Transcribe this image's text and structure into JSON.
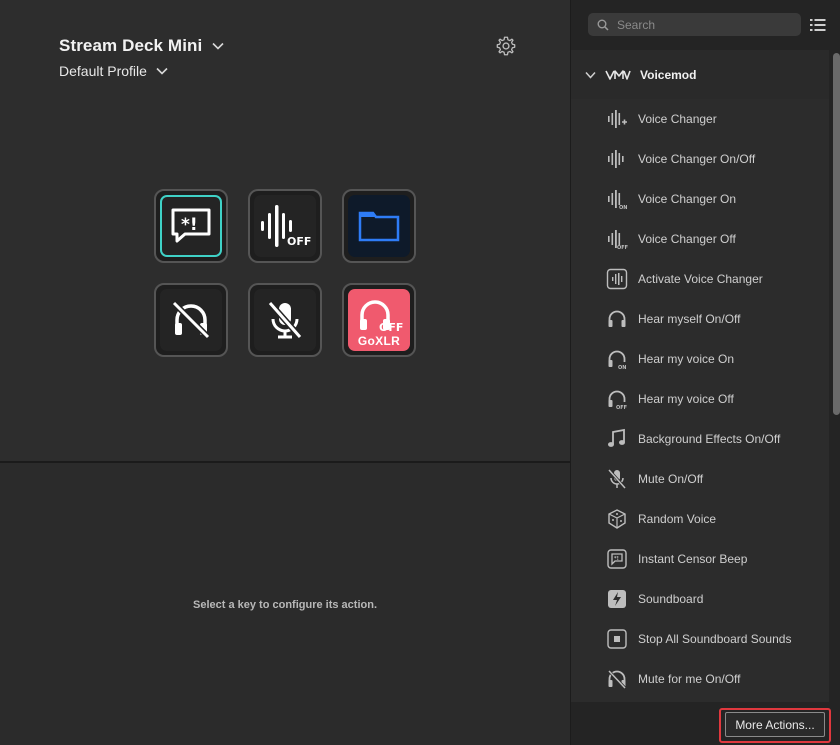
{
  "header": {
    "device_name": "Stream Deck Mini",
    "profile_name": "Default Profile"
  },
  "keys": [
    {
      "icon": "censor-chat-icon",
      "accent": "#3fd2c7"
    },
    {
      "icon": "voice-changer-off-icon",
      "badge": "OFF"
    },
    {
      "icon": "folder-icon",
      "accent": "#2e7cf6"
    },
    {
      "icon": "hear-myself-off-icon"
    },
    {
      "icon": "mic-muted-icon"
    },
    {
      "icon": "goxlr-headphones-off-icon",
      "badge": "OFF",
      "label": "GoXLR",
      "accent": "#f05a6e"
    }
  ],
  "inspector": {
    "hint": "Select a key to configure its action."
  },
  "actions_panel": {
    "search_placeholder": "Search",
    "category": "Voicemod",
    "items": [
      {
        "label": "Voice Changer",
        "icon": "voice-changer-icon"
      },
      {
        "label": "Voice Changer On/Off",
        "icon": "voice-changer-toggle-icon"
      },
      {
        "label": "Voice Changer On",
        "icon": "voice-changer-on-icon"
      },
      {
        "label": "Voice Changer Off",
        "icon": "voice-changer-off-icon"
      },
      {
        "label": "Activate Voice Changer",
        "icon": "activate-voice-changer-icon"
      },
      {
        "label": "Hear myself On/Off",
        "icon": "headphones-icon"
      },
      {
        "label": "Hear my voice On",
        "icon": "headphones-on-icon"
      },
      {
        "label": "Hear my voice Off",
        "icon": "headphones-off-icon"
      },
      {
        "label": "Background Effects On/Off",
        "icon": "music-note-icon"
      },
      {
        "label": "Mute On/Off",
        "icon": "mic-mute-icon"
      },
      {
        "label": "Random Voice",
        "icon": "dice-icon"
      },
      {
        "label": "Instant Censor Beep",
        "icon": "censor-beep-icon"
      },
      {
        "label": "Soundboard",
        "icon": "soundboard-icon"
      },
      {
        "label": "Stop All Soundboard Sounds",
        "icon": "stop-icon"
      },
      {
        "label": "Mute for me On/Off",
        "icon": "headphones-mute-icon"
      }
    ],
    "more_actions_label": "More Actions..."
  }
}
